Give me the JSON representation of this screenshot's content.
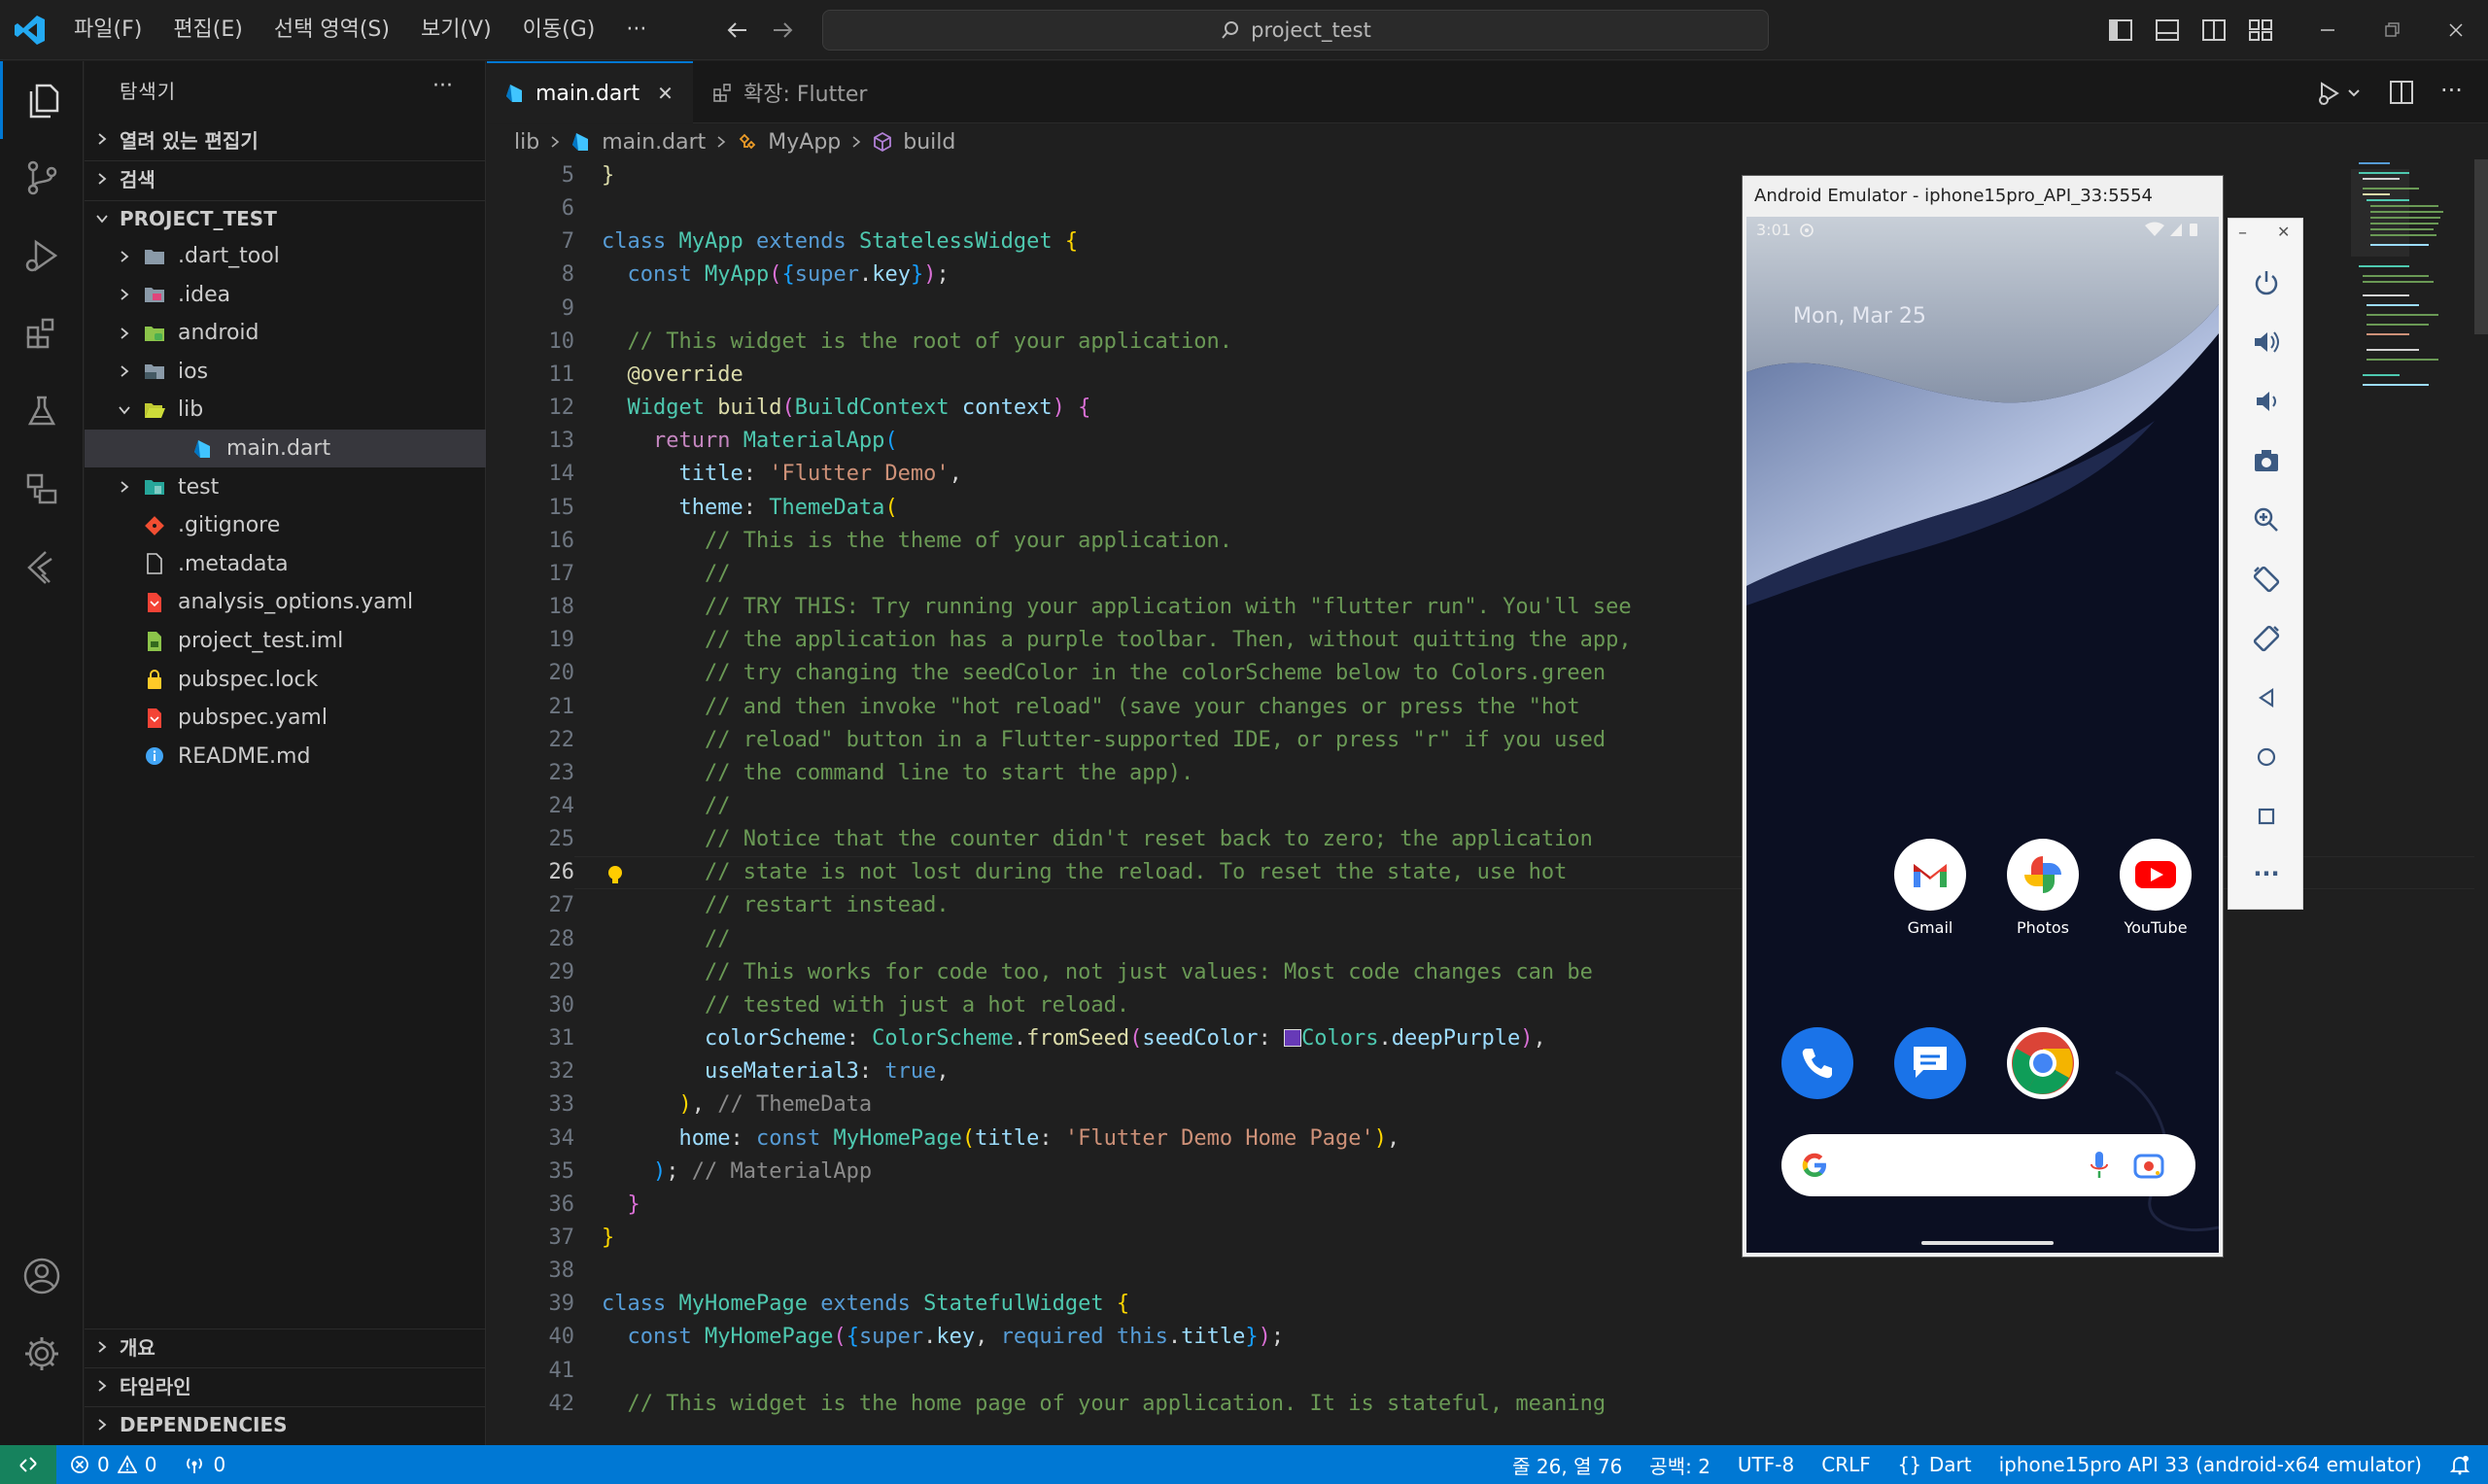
{
  "menu": [
    "파일(F)",
    "편집(E)",
    "선택 영역(S)",
    "보기(V)",
    "이동(G)",
    "···"
  ],
  "command_center": {
    "text": "project_test"
  },
  "sidebar": {
    "title": "탐색기",
    "more": "···",
    "sections_top": [
      "열려 있는 편집기",
      "검색"
    ],
    "project": "PROJECT_TEST",
    "tree": [
      {
        "label": ".dart_tool",
        "icon": "folder-icon",
        "type": "folder",
        "depth": 0
      },
      {
        "label": ".idea",
        "icon": "idea-folder-icon",
        "type": "folder",
        "depth": 0
      },
      {
        "label": "android",
        "icon": "android-folder-icon",
        "type": "folder",
        "depth": 0
      },
      {
        "label": "ios",
        "icon": "ios-folder-icon",
        "type": "folder",
        "depth": 0
      },
      {
        "label": "lib",
        "icon": "lib-folder-open-icon",
        "type": "folder-open",
        "depth": 0
      },
      {
        "label": "main.dart",
        "icon": "dart-file-icon",
        "type": "file",
        "depth": 1
      },
      {
        "label": "test",
        "icon": "test-folder-icon",
        "type": "folder",
        "depth": 0
      },
      {
        "label": ".gitignore",
        "icon": "git-file-icon",
        "type": "file",
        "depth": 0
      },
      {
        "label": ".metadata",
        "icon": "file-icon",
        "type": "file",
        "depth": 0
      },
      {
        "label": "analysis_options.yaml",
        "icon": "yaml-file-icon",
        "type": "file",
        "depth": 0
      },
      {
        "label": "project_test.iml",
        "icon": "iml-file-icon",
        "type": "file",
        "depth": 0
      },
      {
        "label": "pubspec.lock",
        "icon": "lock-file-icon",
        "type": "file",
        "depth": 0
      },
      {
        "label": "pubspec.yaml",
        "icon": "yaml-file-icon",
        "type": "file",
        "depth": 0
      },
      {
        "label": "README.md",
        "icon": "info-file-icon",
        "type": "file",
        "depth": 0
      }
    ],
    "sections_bottom": [
      "개요",
      "타임라인",
      "DEPENDENCIES"
    ]
  },
  "tabs": [
    {
      "label": "main.dart",
      "active": true,
      "close": "✕"
    },
    {
      "label": "확장: Flutter",
      "active": false
    }
  ],
  "breadcrumb": {
    "folder": "lib",
    "file": "main.dart",
    "class": "MyApp",
    "method": "build"
  },
  "editor": {
    "current_line": 26,
    "lines": [
      "5",
      "6",
      "7",
      "8",
      "9",
      "10",
      "11",
      "12",
      "13",
      "14",
      "15",
      "16",
      "17",
      "18",
      "19",
      "20",
      "21",
      "22",
      "23",
      "24",
      "25",
      "26",
      "27",
      "28",
      "29",
      "30",
      "31",
      "32",
      "33",
      "34",
      "35",
      "36",
      "37",
      "38",
      "39",
      "40",
      "41",
      "42"
    ]
  },
  "emulator": {
    "title": "Android Emulator - iphone15pro_API_33:5554",
    "time": "3:01",
    "date": "Mon, Mar 25",
    "apps": [
      "Gmail",
      "Photos",
      "YouTube"
    ],
    "min": "–",
    "close": "✕",
    "more": "···"
  },
  "statusbar": {
    "errors": "0",
    "warnings": "0",
    "ports": "0",
    "cursor": "줄 26, 열 76",
    "spaces": "공백: 2",
    "encoding": "UTF-8",
    "eol": "CRLF",
    "language": "Dart",
    "device": "iphone15pro API 33 (android-x64 emulator)"
  },
  "colors": {
    "accent": "#0078d4",
    "background": "#1f1f1f",
    "sidebar": "#181818"
  }
}
